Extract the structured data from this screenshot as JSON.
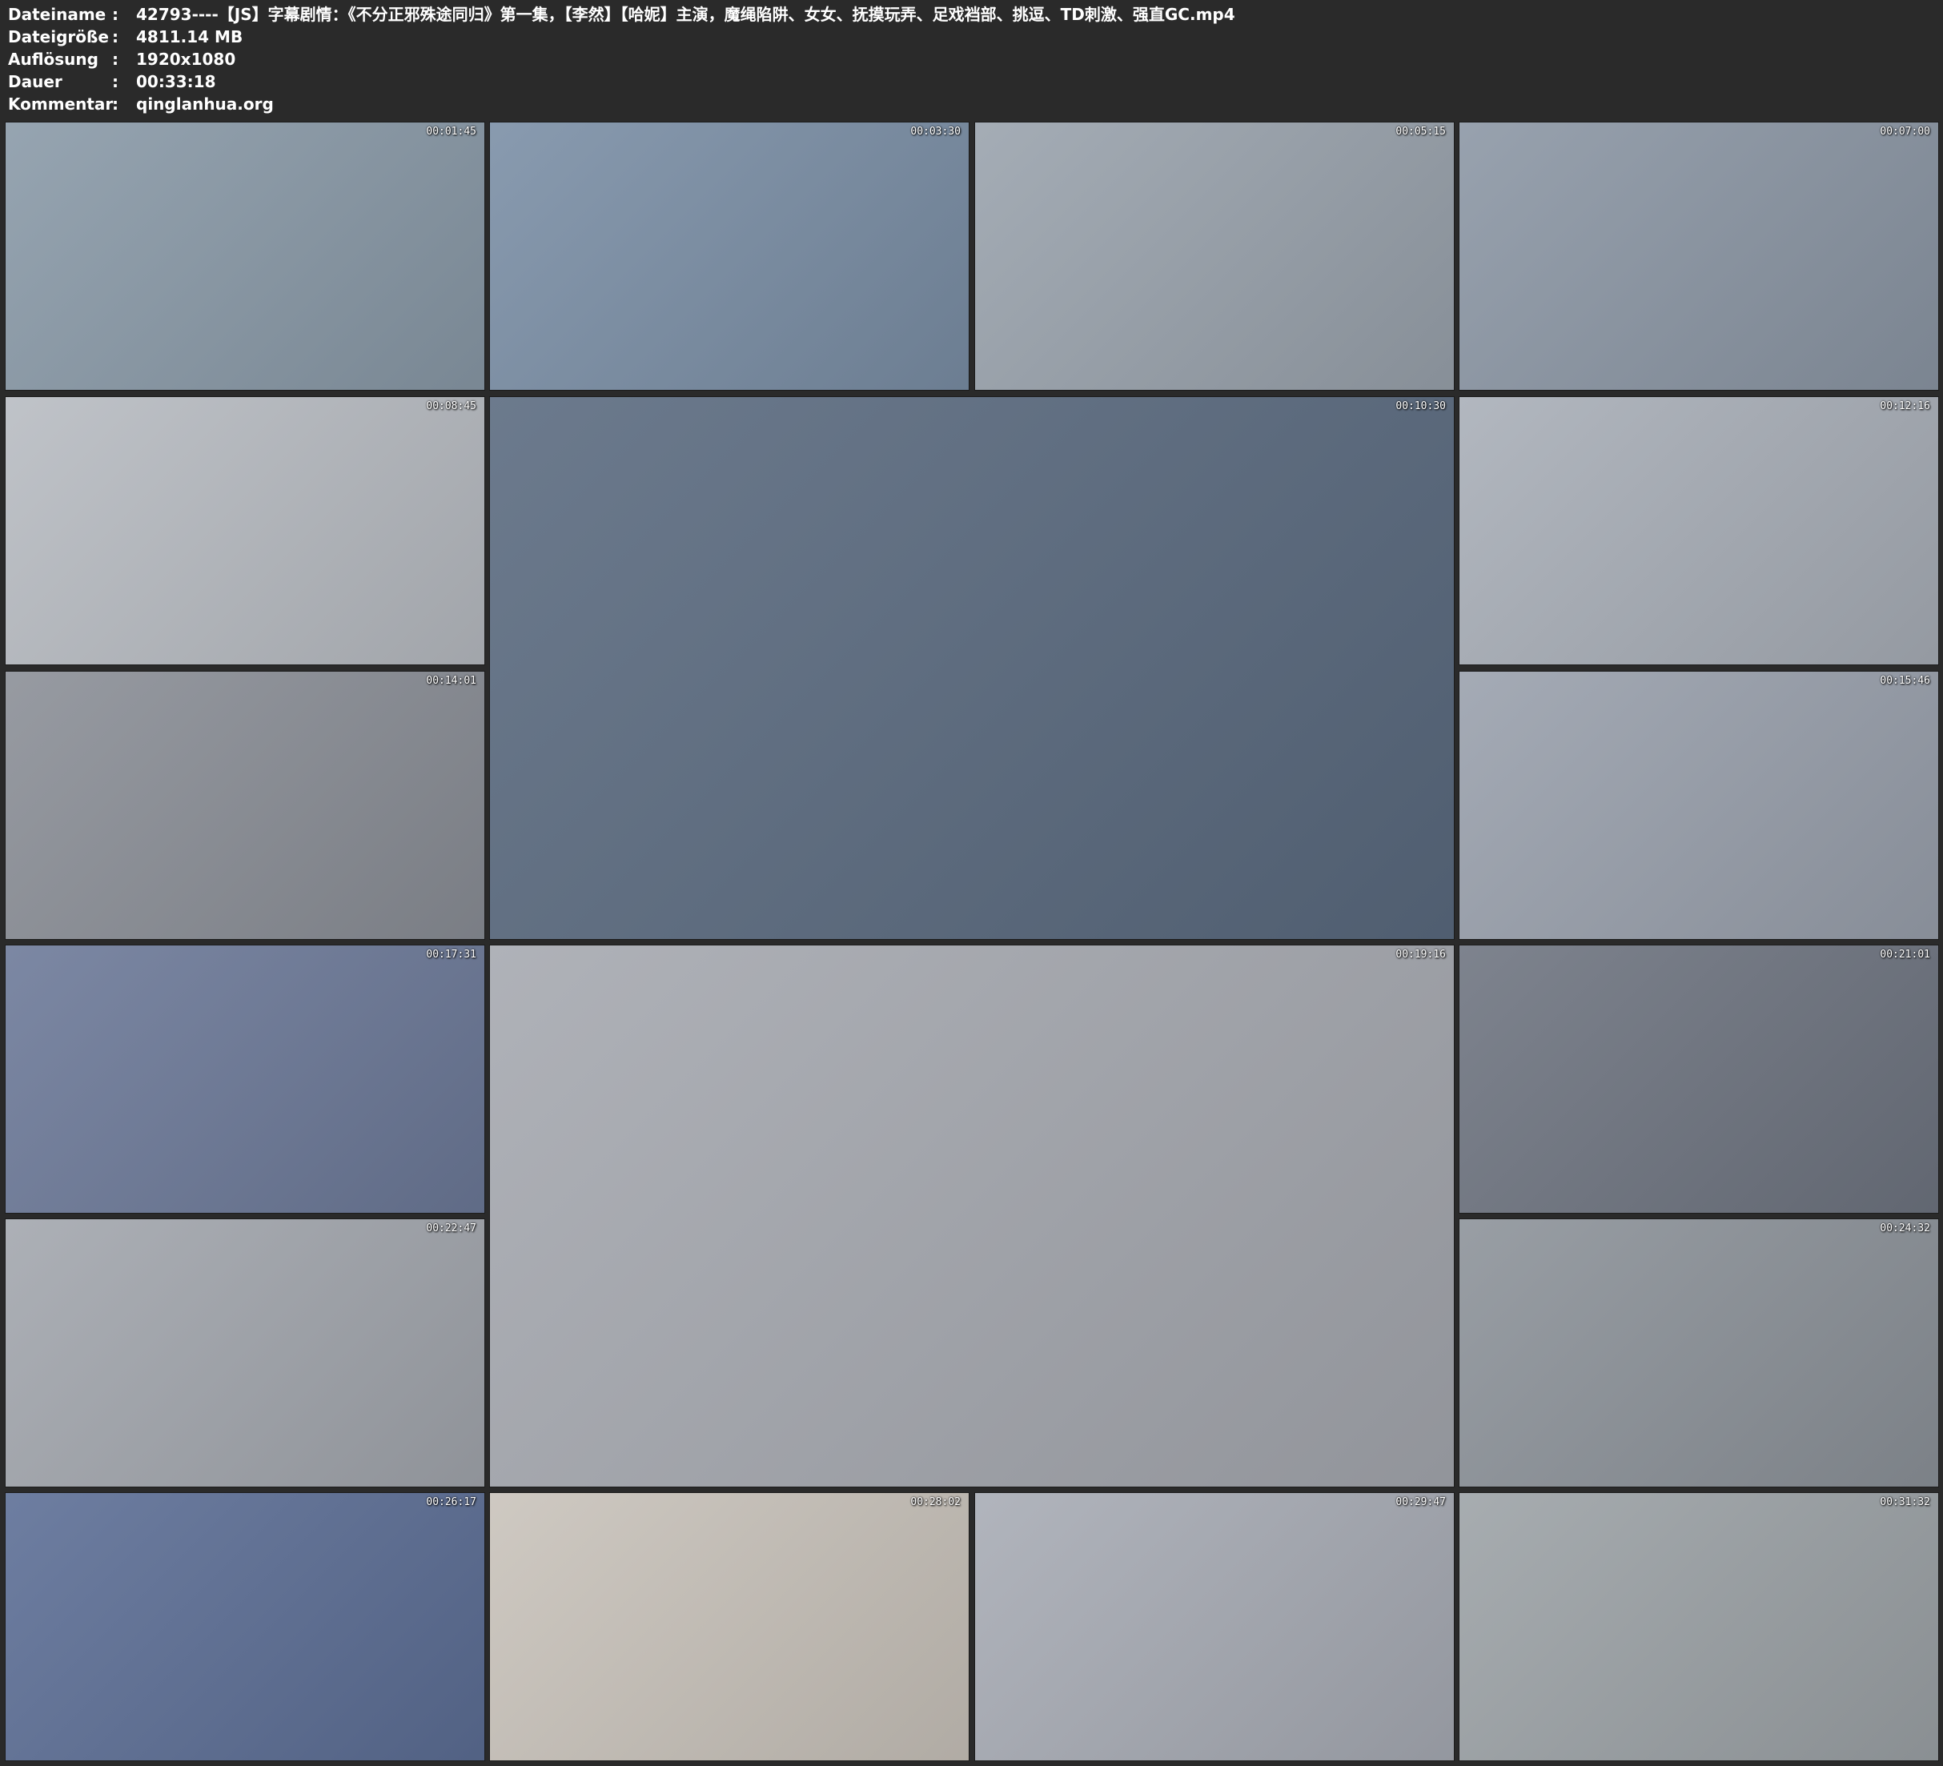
{
  "info": [
    {
      "label": "Dateiname",
      "value": "42793----【JS】字幕剧情：《不分正邪殊途同归》第一集，【李然】【哈妮】主演，魔绳陷阱、女女、抚摸玩弄、足戏裆部、挑逗、TD刺激、强直GC.mp4"
    },
    {
      "label": "Dateigröße",
      "value": "4811.14 MB"
    },
    {
      "label": "Auflösung",
      "value": "1920x1080"
    },
    {
      "label": "Dauer",
      "value": "00:33:18"
    },
    {
      "label": "Kommentar",
      "value": "qinglanhua.org"
    }
  ],
  "separator": ":",
  "thumbnails": [
    {
      "time": "00:01:45",
      "color": "#8a9aa8"
    },
    {
      "time": "00:03:30",
      "color": "#7b8fa6"
    },
    {
      "time": "00:05:15",
      "color": "#9aa3ad"
    },
    {
      "time": "00:07:00",
      "color": "#8c97a5"
    },
    {
      "time": "00:08:45",
      "color": "#b8bcc2"
    },
    {
      "time": "00:10:30",
      "color": "#5b6b80"
    },
    {
      "time": "00:12:16",
      "color": "#a9afb8"
    },
    {
      "time": "00:14:01",
      "color": "#8b8f97"
    },
    {
      "time": "00:15:46",
      "color": "#9aa1ad"
    },
    {
      "time": "00:17:31",
      "color": "#6d7a99"
    },
    {
      "time": "00:19:16",
      "color": "#a6a9b0"
    },
    {
      "time": "00:21:01",
      "color": "#6f7581"
    },
    {
      "time": "00:22:47",
      "color": "#a3a7ae"
    },
    {
      "time": "00:24:32",
      "color": "#8d939a"
    },
    {
      "time": "00:26:17",
      "color": "#5d6f96"
    },
    {
      "time": "00:28:02",
      "color": "#c9c3bb"
    },
    {
      "time": "00:29:47",
      "color": "#a8acb5"
    },
    {
      "time": "00:31:32",
      "color": "#9da3a7"
    }
  ]
}
